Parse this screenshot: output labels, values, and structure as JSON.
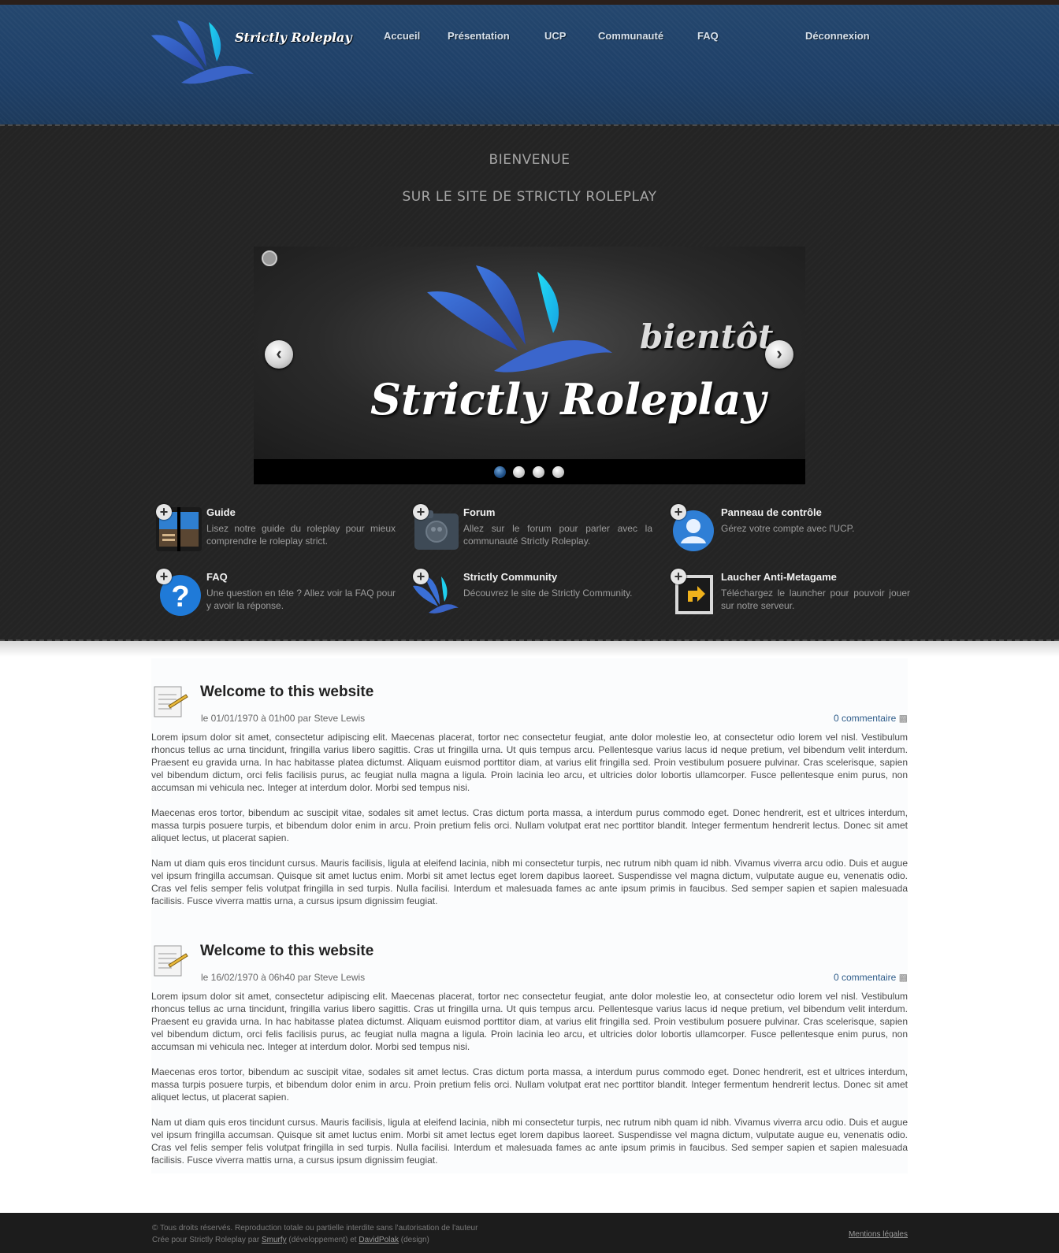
{
  "site": {
    "logo_text": "Strictly Roleplay"
  },
  "nav": {
    "items": [
      "Accueil",
      "Présentation",
      "UCP",
      "Communauté",
      "FAQ"
    ],
    "logout": "Déconnexion"
  },
  "hero": {
    "heading1": "BIENVENUE",
    "heading2": "SUR LE SITE DE STRICTLY ROLEPLAY",
    "slide_title": "Strictly Roleplay",
    "slide_badge": "bientôt",
    "slide_count": 4,
    "active_slide": 1,
    "prev": "‹",
    "next": "›"
  },
  "features": [
    {
      "title": "Guide",
      "desc": "Lisez notre guide du roleplay pour mieux comprendre le roleplay strict.",
      "icon": "book-icon"
    },
    {
      "title": "Forum",
      "desc": "Allez sur le forum pour parler avec la communauté Strictly Roleplay.",
      "icon": "forum-folder-icon"
    },
    {
      "title": "Panneau de contrôle",
      "desc": "Gérez votre compte avec l'UCP.",
      "icon": "user-control-icon"
    },
    {
      "title": "FAQ",
      "desc": "Une question en tête ? Allez voir la FAQ pour y avoir la réponse.",
      "icon": "question-icon"
    },
    {
      "title": "Strictly Community",
      "desc": "Découvrez le site de Strictly Community.",
      "icon": "community-logo-icon"
    },
    {
      "title": "Laucher Anti-Metagame",
      "desc": "Téléchargez le launcher pour pouvoir jouer sur notre serveur.",
      "icon": "launcher-shortcut-icon"
    }
  ],
  "articles": [
    {
      "title": "Welcome to this website",
      "meta": "le 01/01/1970 à 01h00 par Steve Lewis",
      "comments": "0 commentaire",
      "paragraphs": [
        "Lorem ipsum dolor sit amet, consectetur adipiscing elit. Maecenas placerat, tortor nec consectetur feugiat, ante dolor molestie leo, at consectetur odio lorem vel nisl. Vestibulum rhoncus tellus ac urna tincidunt, fringilla varius libero sagittis. Cras ut fringilla urna. Ut quis tempus arcu. Pellentesque varius lacus id neque pretium, vel bibendum velit interdum. Praesent eu gravida urna. In hac habitasse platea dictumst. Aliquam euismod porttitor diam, at varius elit fringilla sed. Proin vestibulum posuere pulvinar. Cras scelerisque, sapien vel bibendum dictum, orci felis facilisis purus, ac feugiat nulla magna a ligula. Proin lacinia leo arcu, et ultricies dolor lobortis ullamcorper. Fusce pellentesque enim purus, non accumsan mi vehicula nec. Integer at interdum dolor. Morbi sed tempus nisi.",
        "Maecenas eros tortor, bibendum ac suscipit vitae, sodales sit amet lectus. Cras dictum porta massa, a interdum purus commodo eget. Donec hendrerit, est et ultrices interdum, massa turpis posuere turpis, et bibendum dolor enim in arcu. Proin pretium felis orci. Nullam volutpat erat nec porttitor blandit. Integer fermentum hendrerit lectus. Donec sit amet aliquet lectus, ut placerat sapien.",
        "Nam ut diam quis eros tincidunt cursus. Mauris facilisis, ligula at eleifend lacinia, nibh mi consectetur turpis, nec rutrum nibh quam id nibh. Vivamus viverra arcu odio. Duis et augue vel ipsum fringilla accumsan. Quisque sit amet luctus enim. Morbi sit amet lectus eget lorem dapibus laoreet. Suspendisse vel magna dictum, vulputate augue eu, venenatis odio. Cras vel felis semper felis volutpat fringilla in sed turpis. Nulla facilisi. Interdum et malesuada fames ac ante ipsum primis in faucibus. Sed semper sapien et sapien malesuada facilisis. Fusce viverra mattis urna, a cursus ipsum dignissim feugiat."
      ]
    },
    {
      "title": "Welcome to this website",
      "meta": "le 16/02/1970 à 06h40 par Steve Lewis",
      "comments": "0 commentaire",
      "paragraphs": [
        "Lorem ipsum dolor sit amet, consectetur adipiscing elit. Maecenas placerat, tortor nec consectetur feugiat, ante dolor molestie leo, at consectetur odio lorem vel nisl. Vestibulum rhoncus tellus ac urna tincidunt, fringilla varius libero sagittis. Cras ut fringilla urna. Ut quis tempus arcu. Pellentesque varius lacus id neque pretium, vel bibendum velit interdum. Praesent eu gravida urna. In hac habitasse platea dictumst. Aliquam euismod porttitor diam, at varius elit fringilla sed. Proin vestibulum posuere pulvinar. Cras scelerisque, sapien vel bibendum dictum, orci felis facilisis purus, ac feugiat nulla magna a ligula. Proin lacinia leo arcu, et ultricies dolor lobortis ullamcorper. Fusce pellentesque enim purus, non accumsan mi vehicula nec. Integer at interdum dolor. Morbi sed tempus nisi.",
        "Maecenas eros tortor, bibendum ac suscipit vitae, sodales sit amet lectus. Cras dictum porta massa, a interdum purus commodo eget. Donec hendrerit, est et ultrices interdum, massa turpis posuere turpis, et bibendum dolor enim in arcu. Proin pretium felis orci. Nullam volutpat erat nec porttitor blandit. Integer fermentum hendrerit lectus. Donec sit amet aliquet lectus, ut placerat sapien.",
        "Nam ut diam quis eros tincidunt cursus. Mauris facilisis, ligula at eleifend lacinia, nibh mi consectetur turpis, nec rutrum nibh quam id nibh. Vivamus viverra arcu odio. Duis et augue vel ipsum fringilla accumsan. Quisque sit amet luctus enim. Morbi sit amet lectus eget lorem dapibus laoreet. Suspendisse vel magna dictum, vulputate augue eu, venenatis odio. Cras vel felis semper felis volutpat fringilla in sed turpis. Nulla facilisi. Interdum et malesuada fames ac ante ipsum primis in faucibus. Sed semper sapien et sapien malesuada facilisis. Fusce viverra mattis urna, a cursus ipsum dignissim feugiat."
      ]
    }
  ],
  "footer": {
    "rights": "© Tous droits réservés. Reproduction totale ou partielle interdite sans l'autorisation de l'auteur",
    "credit_prefix": "Crée pour Strictly Roleplay par",
    "dev_name": "Smurfy",
    "dev_role": "(développement) et",
    "design_name": "DavidPolak",
    "design_role": "(design)",
    "legal": "Mentions légales"
  },
  "colors": {
    "header_blue": "#1f4068",
    "dark_band": "#242424",
    "link_blue": "#2e5c8a",
    "accent_cyan": "#19c9e8"
  }
}
